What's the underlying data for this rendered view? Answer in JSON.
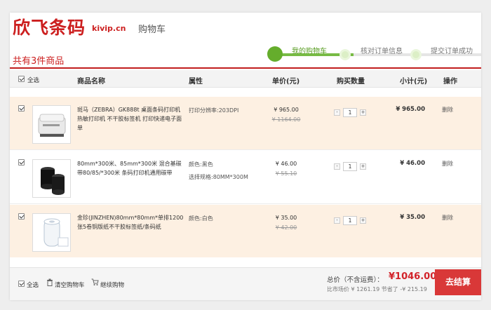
{
  "header": {
    "logo_text": "欣飞条码",
    "logo_domain": "kivip.cn",
    "page_title": "购物车",
    "cart_count_title": "共有3件商品"
  },
  "steps": [
    {
      "label": "我的购物车",
      "active": true
    },
    {
      "label": "核对订单信息",
      "active": false
    },
    {
      "label": "提交订单成功",
      "active": false
    }
  ],
  "table_header": {
    "select_all": "全选",
    "product_name": "商品名称",
    "attributes": "属性",
    "unit_price": "单价(元)",
    "quantity": "购买数量",
    "subtotal": "小计(元)",
    "action": "操作"
  },
  "items": [
    {
      "name": "斑马（ZEBRA）GK888t 桌面条码打印机 热敏打印机 不干胶标签机 打印快递电子面单",
      "attr1": "打印分辨率:203DPI",
      "attr2": "",
      "price": "¥ 965.00",
      "old_price": "¥ 1164.00",
      "qty": "1",
      "subtotal": "¥ 965.00",
      "delete": "删除"
    },
    {
      "name": "80mm*300米、85mm*300米 混合基碳带80/85/*300米 条码打印机通用碳带",
      "attr1": "颜色:黑色",
      "attr2": "选择规格:80MM*300M",
      "price": "¥ 46.00",
      "old_price": "¥ 55.10",
      "qty": "1",
      "subtotal": "¥ 46.00",
      "delete": "删除"
    },
    {
      "name": "金珍(JINZHEN)80mm*80mm*单排1200张5卷铜版纸不干胶标签纸/条码纸",
      "attr1": "颜色:白色",
      "attr2": "",
      "price": "¥ 35.00",
      "old_price": "¥ 42.00",
      "qty": "1",
      "subtotal": "¥ 35.00",
      "delete": "删除"
    }
  ],
  "qty_controls": {
    "minus": "-",
    "plus": "+"
  },
  "footer": {
    "select_all": "全选",
    "clear_cart": "清空购物车",
    "continue_shopping": "继续购物",
    "total_label": "总价（不含运费）：",
    "total_amount": "¥1046.00",
    "market_info": "比市场价 ¥ 1261.19 节省了 -¥ 215.19",
    "checkout": "去结算"
  },
  "colors": {
    "brand_red": "#cc1f1f",
    "step_green": "#65ad2c",
    "row_highlight": "#fdf0e2",
    "checkout_red": "#d93838"
  }
}
